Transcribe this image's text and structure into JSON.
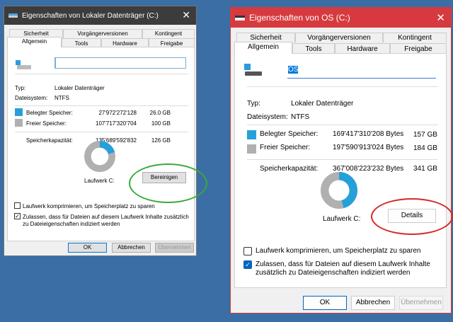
{
  "left": {
    "title": "Eigenschaften von Lokaler Datenträger (C:)",
    "tabs_row1": [
      "Sicherheit",
      "Vorgängerversionen",
      "Kontingent"
    ],
    "tabs_row2": [
      "Allgemein",
      "Tools",
      "Hardware",
      "Freigabe"
    ],
    "name_value": "",
    "type_label": "Typ:",
    "type_value": "Lokaler Datenträger",
    "fs_label": "Dateisystem:",
    "fs_value": "NTFS",
    "used_label": "Belegter Speicher:",
    "used_bytes": "27'972'272'128",
    "used_size": "26.0 GB",
    "free_label": "Freier Speicher:",
    "free_bytes": "107'717'320'704",
    "free_size": "100 GB",
    "cap_label": "Speicherkapazität:",
    "cap_bytes": "135'689'592'832",
    "cap_size": "126 GB",
    "used_fraction": 0.206,
    "drive_label": "Laufwerk C:",
    "action_button": "Bereinigen",
    "compress_label": "Laufwerk komprimieren, um Speicherplatz zu sparen",
    "index_label_1": "Zulassen, dass für Dateien auf diesem Laufwerk Inhalte zusätzlich",
    "index_label_2": "zu Dateieigenschaften indiziert werden",
    "ok": "OK",
    "cancel": "Abbrechen",
    "apply": "Übernehmen"
  },
  "right": {
    "title": "Eigenschaften von OS (C:)",
    "tabs_row1": [
      "Sicherheit",
      "Vorgängerversionen",
      "Kontingent"
    ],
    "tabs_row2": [
      "Allgemein",
      "Tools",
      "Hardware",
      "Freigabe"
    ],
    "name_value": "OS",
    "type_label": "Typ:",
    "type_value": "Lokaler Datenträger",
    "fs_label": "Dateisystem:",
    "fs_value": "NTFS",
    "used_label": "Belegter Speicher:",
    "used_bytes": "169'417'310'208 Bytes",
    "used_size": "157 GB",
    "free_label": "Freier Speicher:",
    "free_bytes": "197'590'913'024 Bytes",
    "free_size": "184 GB",
    "cap_label": "Speicherkapazität:",
    "cap_bytes": "367'008'223'232 Bytes",
    "cap_size": "341 GB",
    "used_fraction": 0.46,
    "drive_label": "Laufwerk C:",
    "action_button": "Details",
    "compress_label": "Laufwerk komprimieren, um Speicherplatz zu sparen",
    "index_label_1": "Zulassen, dass für Dateien auf diesem Laufwerk Inhalte",
    "index_label_2": "zusätzlich zu Dateieigenschaften indiziert werden",
    "ok": "OK",
    "cancel": "Abbrechen",
    "apply": "Übernehmen"
  },
  "colors": {
    "used": "#26a0da",
    "free": "#b0b0b0",
    "left_title": "#3c3c3c",
    "right_title": "#d63a3f",
    "green_mark": "#3aaa3a",
    "red_mark": "#d42a2a"
  }
}
